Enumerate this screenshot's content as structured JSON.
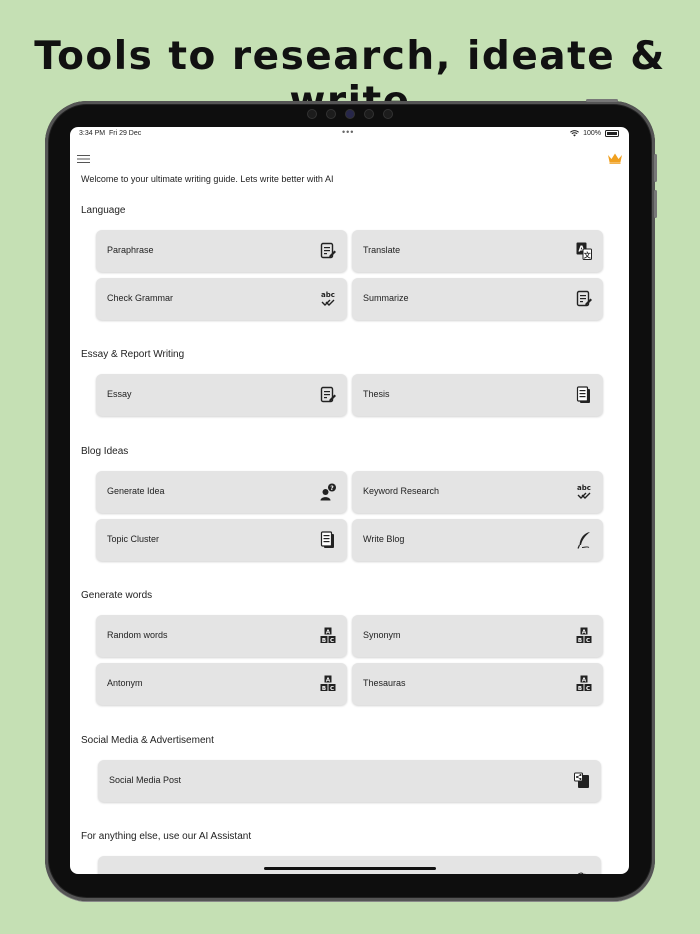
{
  "headline": "Tools to research, ideate & write",
  "status_bar": {
    "time": "3:34 PM",
    "date": "Fri 29 Dec",
    "dots": "•••",
    "battery": "100%"
  },
  "welcome": "Welcome to your ultimate writing guide. Lets write better with AI",
  "sections": {
    "language": {
      "title": "Language",
      "items": [
        {
          "label": "Paraphrase",
          "icon": "edit-document-icon"
        },
        {
          "label": "Translate",
          "icon": "translate-icon"
        },
        {
          "label": "Check Grammar",
          "icon": "spellcheck-icon"
        },
        {
          "label": "Summarize",
          "icon": "edit-document-icon"
        }
      ]
    },
    "essay": {
      "title": "Essay & Report Writing",
      "items": [
        {
          "label": "Essay",
          "icon": "edit-document-icon"
        },
        {
          "label": "Thesis",
          "icon": "documents-icon"
        }
      ]
    },
    "blog": {
      "title": "Blog Ideas",
      "items": [
        {
          "label": "Generate Idea",
          "icon": "person-question-icon"
        },
        {
          "label": "Keyword Research",
          "icon": "spellcheck-icon"
        },
        {
          "label": "Topic Cluster",
          "icon": "documents-icon"
        },
        {
          "label": "Write Blog",
          "icon": "quill-icon"
        }
      ]
    },
    "words": {
      "title": "Generate words",
      "items": [
        {
          "label": "Random words",
          "icon": "abc-blocks-icon"
        },
        {
          "label": "Synonym",
          "icon": "abc-blocks-icon"
        },
        {
          "label": "Antonym",
          "icon": "abc-blocks-icon"
        },
        {
          "label": "Thesauras",
          "icon": "abc-blocks-icon"
        }
      ]
    },
    "social": {
      "title": "Social Media & Advertisement",
      "items": [
        {
          "label": "Social Media Post",
          "icon": "share-post-icon"
        }
      ]
    },
    "assistant": {
      "title": "For anything else, use our AI Assistant"
    }
  },
  "colors": {
    "background": "#c5e0b4",
    "card": "#e4e4e4",
    "crown": "#f0a020"
  }
}
